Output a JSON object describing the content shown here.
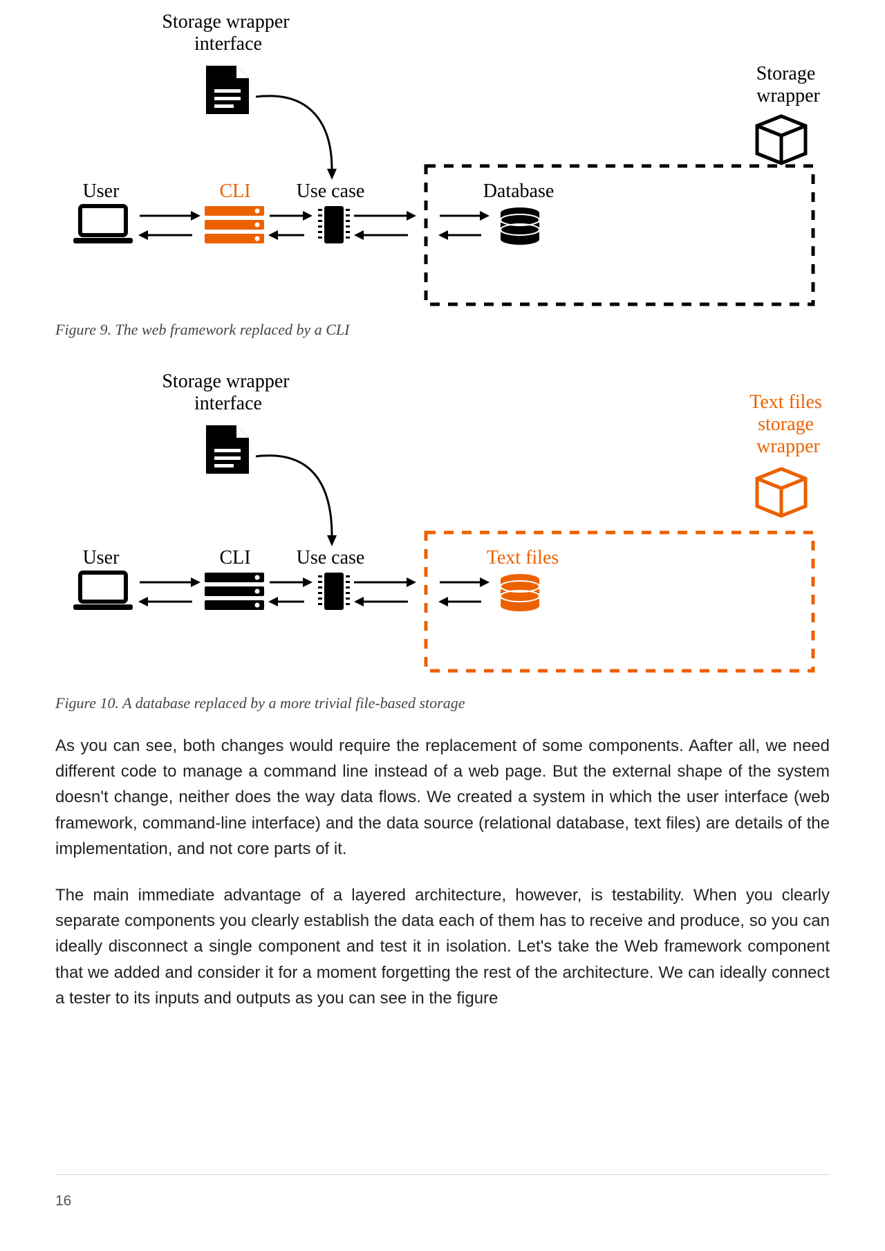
{
  "pageNumber": "16",
  "fig9": {
    "caption": "Figure 9. The web framework replaced by a CLI",
    "labels": {
      "storageWrapperInterface1": "Storage wrapper",
      "storageWrapperInterface2": "interface",
      "storageWrapper1": "Storage",
      "storageWrapper2": "wrapper",
      "user": "User",
      "cli": "CLI",
      "usecase": "Use case",
      "database": "Database"
    }
  },
  "fig10": {
    "caption": "Figure 10. A database replaced by a more trivial file-based storage",
    "labels": {
      "storageWrapperInterface1": "Storage wrapper",
      "storageWrapperInterface2": "interface",
      "textFilesWrapper1": "Text files",
      "textFilesWrapper2": "storage",
      "textFilesWrapper3": "wrapper",
      "user": "User",
      "cli": "CLI",
      "usecase": "Use case",
      "textfiles": "Text files"
    }
  },
  "paragraphs": {
    "p1": "As you can see, both changes would require the replacement of some components. Aafter all, we need different code to manage a command line instead of a web page. But the external shape of the system doesn't change, neither does the way data flows. We created a system in which the user interface (web framework, command-line interface) and the data source (relational database, text files) are details of the implementation, and not core parts of it.",
    "p2": "The main immediate advantage of a layered architecture, however, is testability. When you clearly separate components you clearly establish the data each of them has to receive and produce, so you can ideally disconnect a single component and test it in isolation. Let's take the Web framework component that we added and consider it for a moment forgetting the rest of the architecture. We can ideally connect a tester to its inputs and outputs as you can see in the figure"
  }
}
